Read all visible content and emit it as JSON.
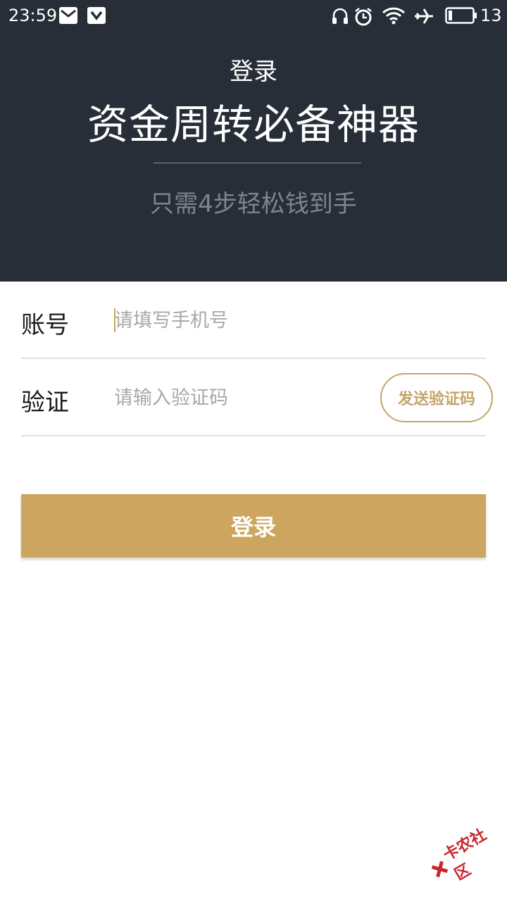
{
  "status_bar": {
    "time": "23:59",
    "battery_level": "13",
    "icons": [
      "mail-icon",
      "shield-app-icon",
      "headphones-icon",
      "alarm-icon",
      "wifi-icon",
      "airplane-icon",
      "battery-icon"
    ]
  },
  "header": {
    "page_title": "登录",
    "headline": "资金周转必备神器",
    "subline": "只需4步轻松钱到手",
    "background": "#272e38"
  },
  "form": {
    "account_label": "账号",
    "account_placeholder": "请填写手机号",
    "code_label": "验证",
    "code_placeholder": "请输入验证码",
    "send_code_label": "发送验证码",
    "accent_color": "#c3a56a"
  },
  "login_button": {
    "label": "登录",
    "color": "#cca65e"
  },
  "watermark": {
    "text": "卡农社区"
  }
}
